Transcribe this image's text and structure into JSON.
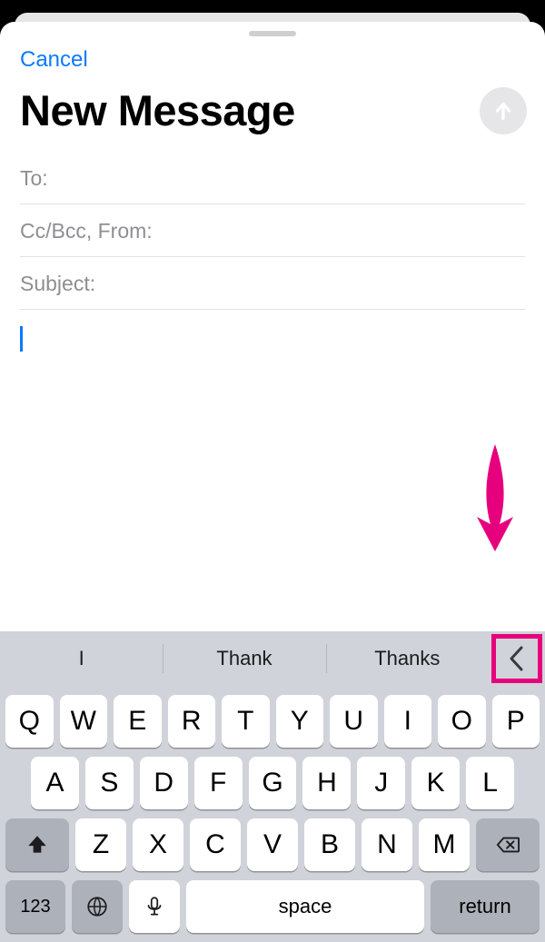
{
  "header": {
    "cancel": "Cancel",
    "title": "New Message"
  },
  "fields": {
    "to_label": "To:",
    "ccbcc_label": "Cc/Bcc, From:",
    "subject_label": "Subject:"
  },
  "predictions": [
    "I",
    "Thank",
    "Thanks"
  ],
  "keyboard": {
    "row1": [
      "Q",
      "W",
      "E",
      "R",
      "T",
      "Y",
      "U",
      "I",
      "O",
      "P"
    ],
    "row2": [
      "A",
      "S",
      "D",
      "F",
      "G",
      "H",
      "J",
      "K",
      "L"
    ],
    "row3": [
      "Z",
      "X",
      "C",
      "V",
      "B",
      "N",
      "M"
    ],
    "numeric": "123",
    "space": "space",
    "return": "return"
  }
}
